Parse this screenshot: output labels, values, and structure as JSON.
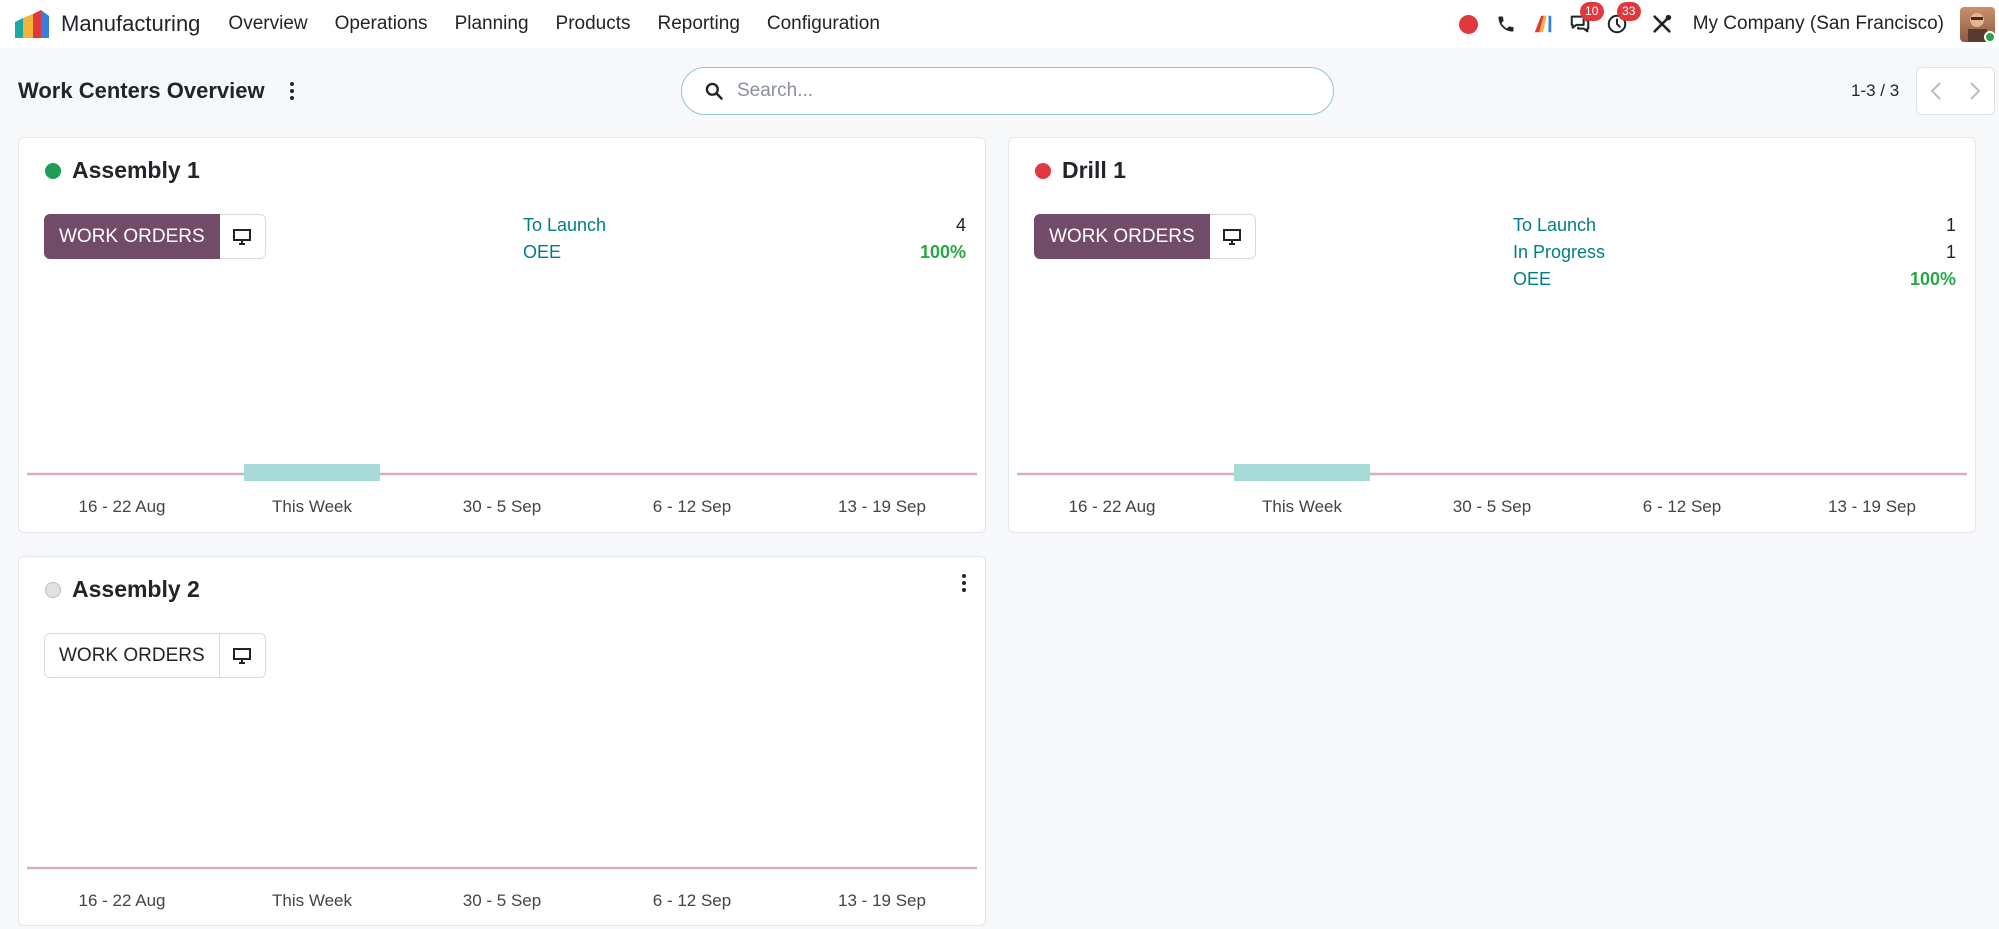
{
  "app": {
    "name": "Manufacturing",
    "menu": [
      "Overview",
      "Operations",
      "Planning",
      "Products",
      "Reporting",
      "Configuration"
    ]
  },
  "systray": {
    "messages_count": "10",
    "activities_count": "33",
    "company": "My Company (San Francisco)",
    "icons": [
      "recording-dot-icon",
      "phone-icon",
      "ai-icon",
      "chat-icon",
      "clock-icon",
      "tools-icon"
    ]
  },
  "control_panel": {
    "title": "Work Centers Overview",
    "search_placeholder": "Search...",
    "pager": "1-3 / 3"
  },
  "colors": {
    "primary": "#714b67",
    "link": "#017e84",
    "success": "#28a745",
    "danger": "#e0383e",
    "muted_dot": "#dfe1e4",
    "bar": "#a6dbd8",
    "line": "#d3b0c6"
  },
  "cards": [
    {
      "name": "Assembly 1",
      "status": "green",
      "button": "WORK ORDERS",
      "stats": [
        {
          "label": "To Launch",
          "value": "4"
        },
        {
          "label": "OEE",
          "value": "100%"
        }
      ]
    },
    {
      "name": "Drill 1",
      "status": "red",
      "button": "WORK ORDERS",
      "stats": [
        {
          "label": "To Launch",
          "value": "1"
        },
        {
          "label": "In Progress",
          "value": "1"
        },
        {
          "label": "OEE",
          "value": "100%"
        }
      ]
    },
    {
      "name": "Assembly 2",
      "status": "grey",
      "button": "WORK ORDERS",
      "stats": []
    }
  ],
  "chart_data": [
    {
      "type": "bar",
      "categories": [
        "16 - 22 Aug",
        "This Week",
        "30 - 5 Sep",
        "6 - 12 Sep",
        "13 - 19 Sep"
      ],
      "values": [
        0,
        1,
        0,
        0,
        0
      ]
    },
    {
      "type": "bar",
      "categories": [
        "16 - 22 Aug",
        "This Week",
        "30 - 5 Sep",
        "6 - 12 Sep",
        "13 - 19 Sep"
      ],
      "values": [
        0,
        1,
        0,
        0,
        0
      ]
    },
    {
      "type": "bar",
      "categories": [
        "16 - 22 Aug",
        "This Week",
        "30 - 5 Sep",
        "6 - 12 Sep",
        "13 - 19 Sep"
      ],
      "values": [
        0,
        0,
        0,
        0,
        0
      ]
    }
  ]
}
